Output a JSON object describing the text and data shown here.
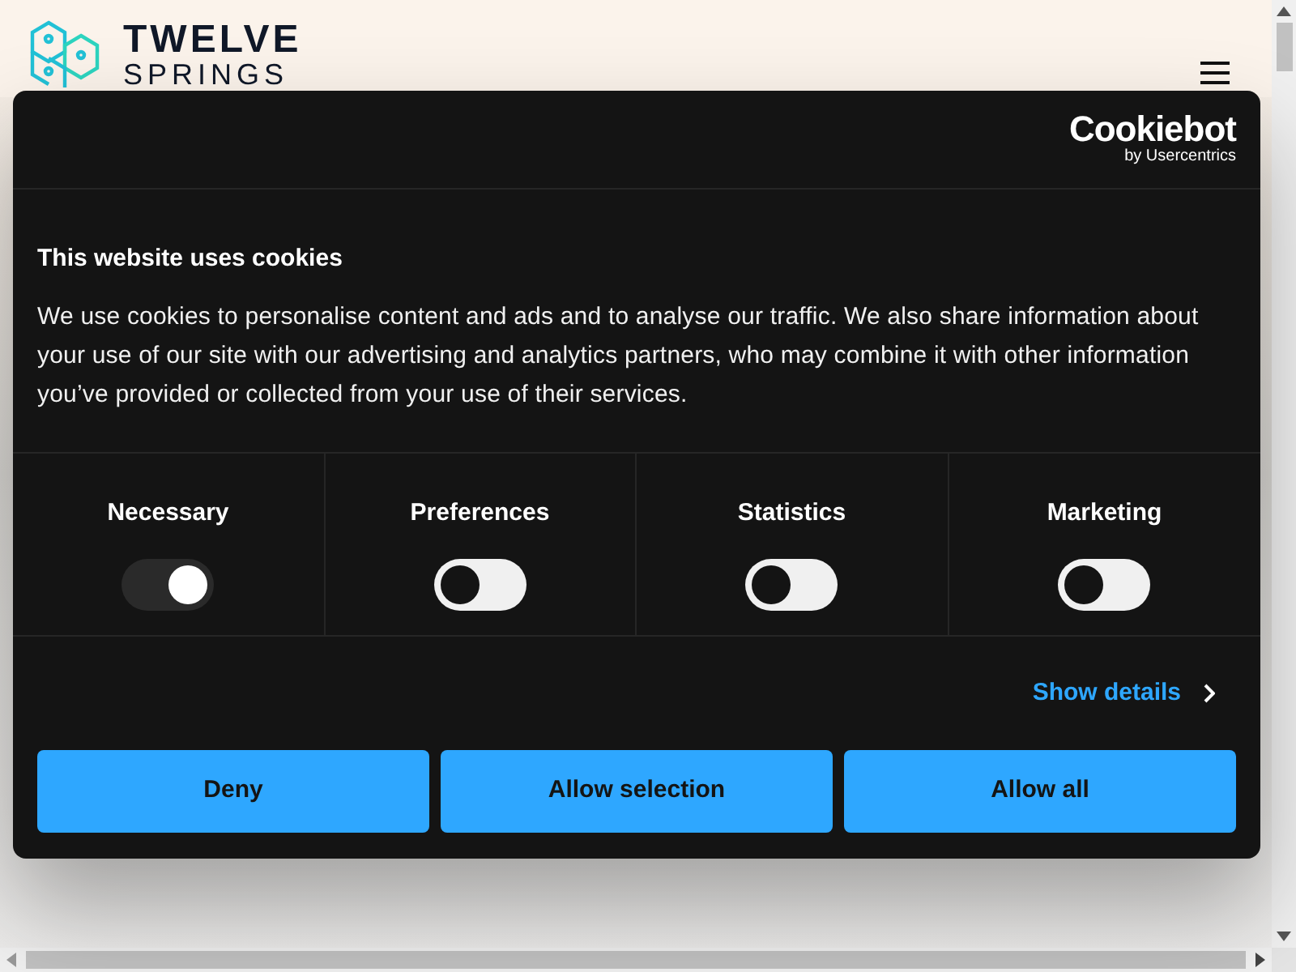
{
  "site_header": {
    "logo_line_1": "TWELVE",
    "logo_line_2": "SPRINGS"
  },
  "cookie_dialog": {
    "brand": "Cookiebot",
    "brand_sub": "by Usercentrics",
    "title": "This website uses cookies",
    "text": "We use cookies to personalise content and ads and to analyse our traffic. We also share information about your use of our site with our advertising and analytics partners, who may combine it with other information you’ve provided or collected from your use of their services.",
    "categories": [
      {
        "label": "Necessary",
        "checked": true,
        "disabled": true
      },
      {
        "label": "Preferences",
        "checked": false,
        "disabled": false
      },
      {
        "label": "Statistics",
        "checked": false,
        "disabled": false
      },
      {
        "label": "Marketing",
        "checked": false,
        "disabled": false
      }
    ],
    "details_link": "Show details",
    "buttons": [
      "Deny",
      "Allow selection",
      "Allow all"
    ]
  }
}
